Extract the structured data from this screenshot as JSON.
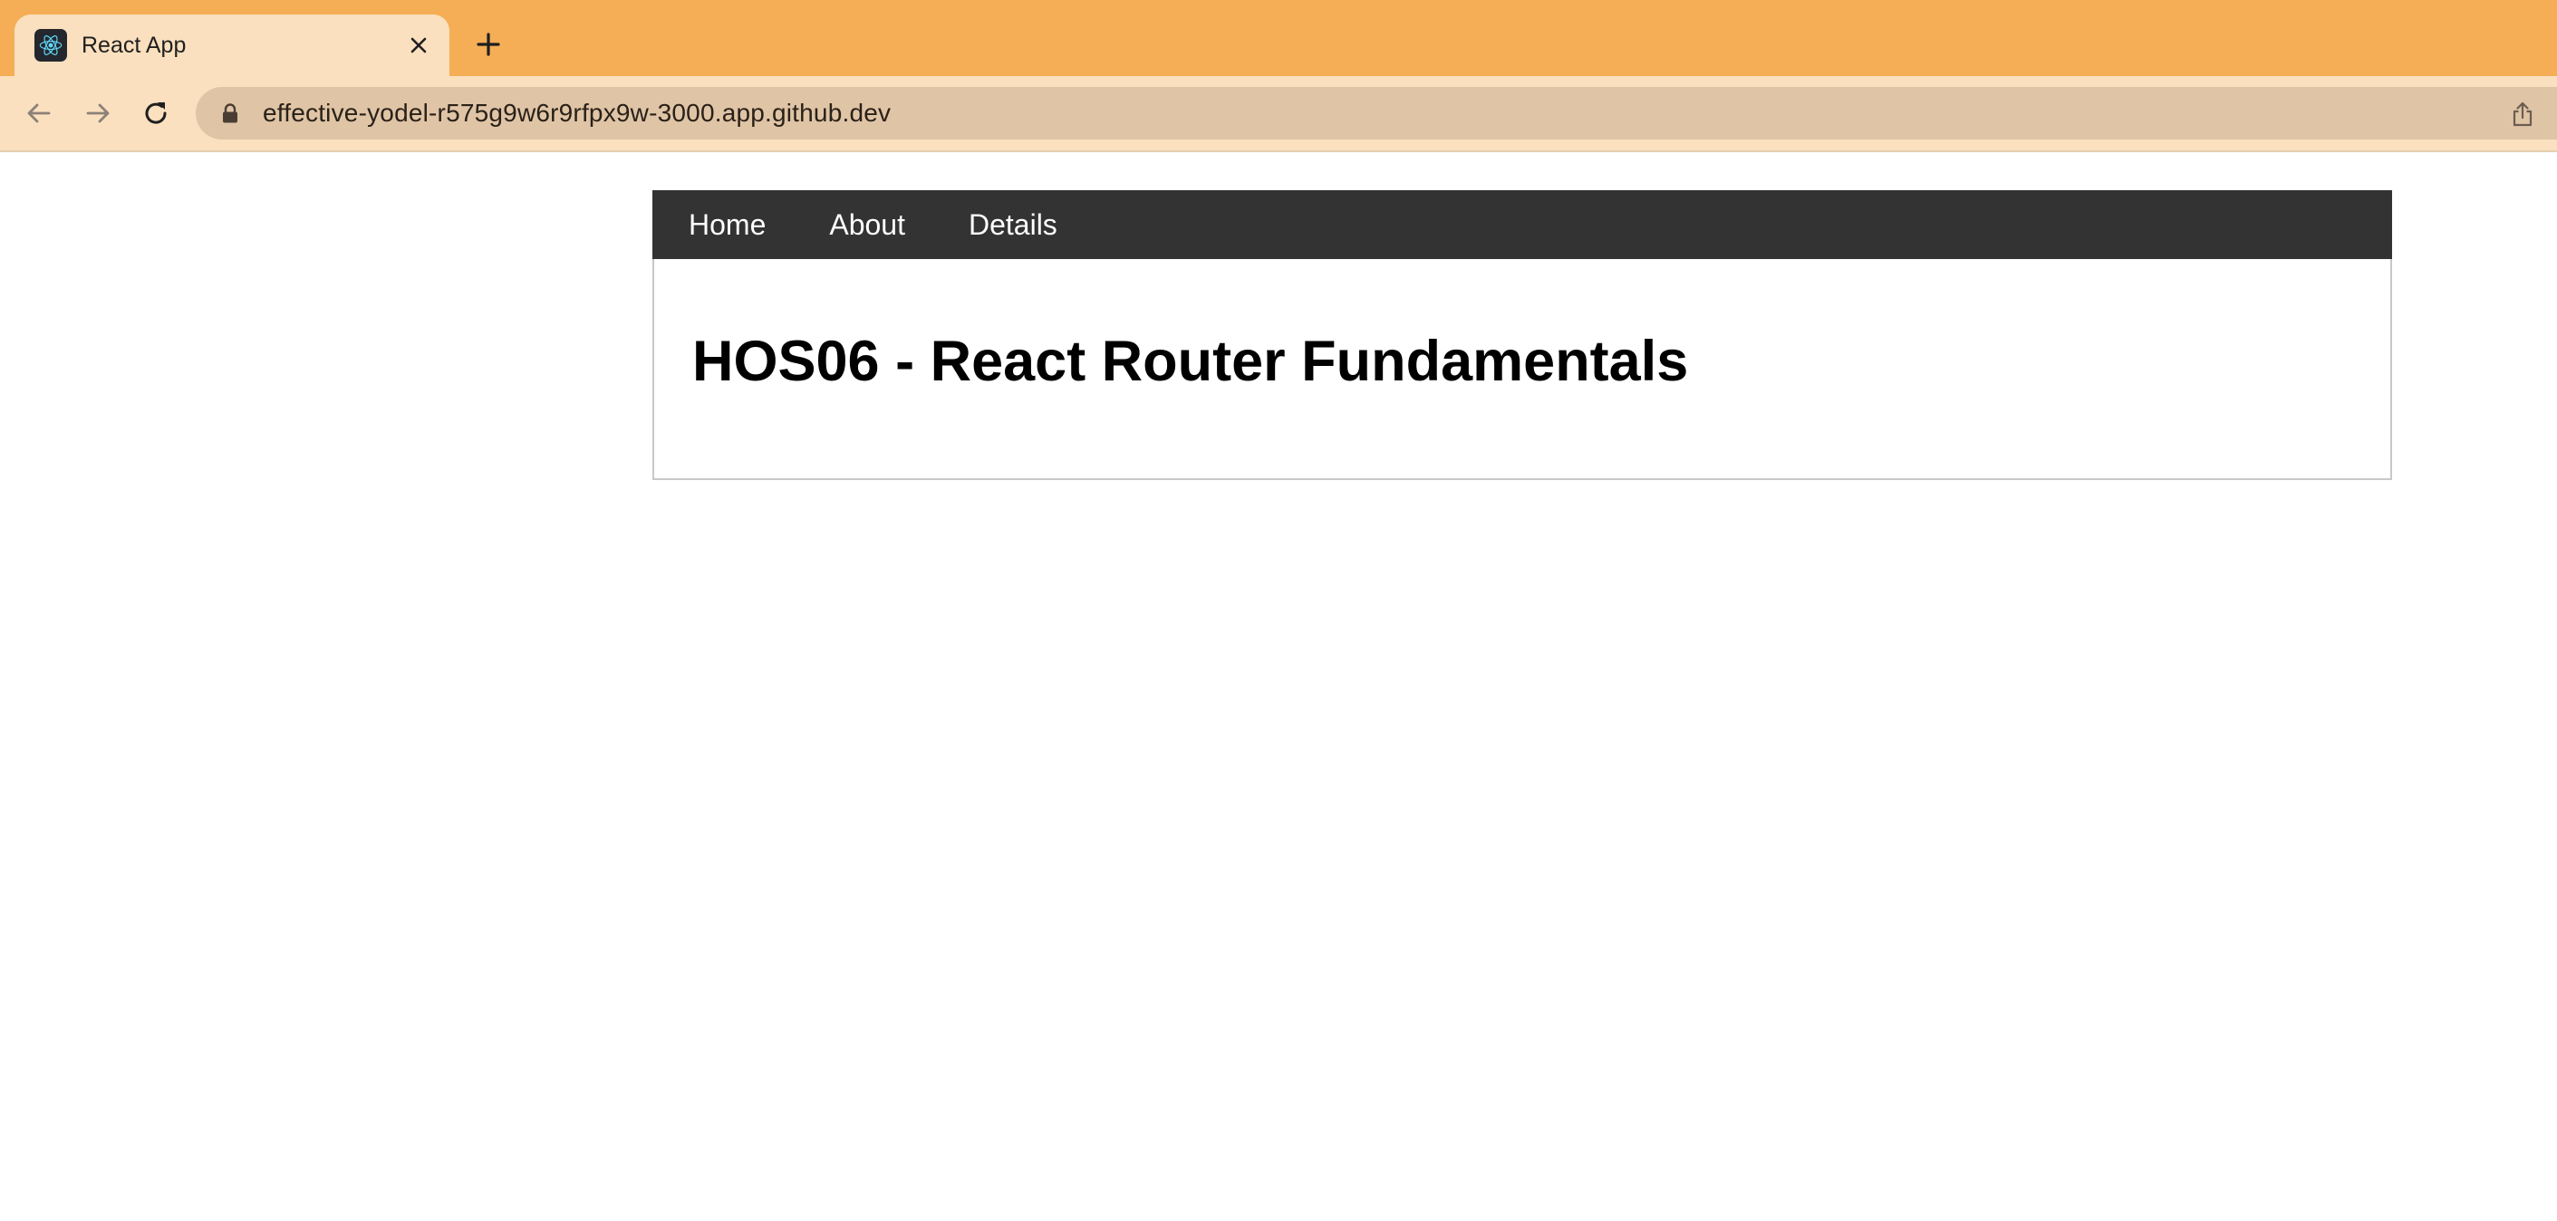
{
  "browser": {
    "tab": {
      "title": "React App",
      "favicon": "react-logo-icon"
    },
    "new_tab_icon": "plus-icon",
    "toolbar": {
      "back_icon": "arrow-left-icon",
      "forward_icon": "arrow-right-icon",
      "reload_icon": "reload-icon",
      "lock_icon": "lock-icon",
      "url": "effective-yodel-r575g9w6r9rfpx9w-3000.app.github.dev",
      "share_icon": "share-icon"
    },
    "colors": {
      "tabstrip": "#f5ae55",
      "active_tab": "#fae0be",
      "omnibox": "#dfc4a6"
    }
  },
  "app": {
    "nav": {
      "items": [
        {
          "label": "Home"
        },
        {
          "label": "About"
        },
        {
          "label": "Details"
        }
      ],
      "background": "#333333"
    },
    "heading": "HOS06 - React Router Fundamentals"
  }
}
